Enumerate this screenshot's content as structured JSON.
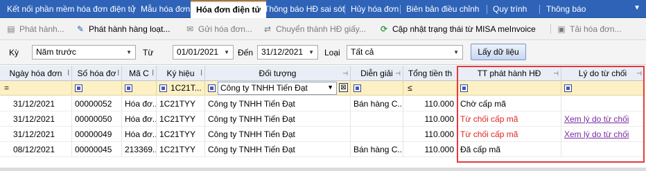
{
  "tabs": [
    {
      "label": "Kết nối phần mềm hóa đơn điện tử"
    },
    {
      "label": "Mẫu hóa đơn"
    },
    {
      "label": "Hóa đơn điện tử"
    },
    {
      "label": "Thông báo HĐ sai sót"
    },
    {
      "label": "Hủy hóa đơn"
    },
    {
      "label": "Biên bản điều chỉnh"
    },
    {
      "label": "Quy trình"
    },
    {
      "label": "Thông báo"
    }
  ],
  "toolbar": {
    "issue": "Phát hành...",
    "issue_batch": "Phát hành hàng loạt...",
    "send": "Gửi hóa đơn...",
    "convert": "Chuyển thành HĐ giấy...",
    "update_status": "Cập nhật trạng thái từ MISA meInvoice",
    "download": "Tải hóa đơn..."
  },
  "filter": {
    "period_label": "Kỳ",
    "period_value": "Năm trước",
    "from_label": "Từ",
    "from_value": "01/01/2021",
    "to_label": "Đến",
    "to_value": "31/12/2021",
    "type_label": "Loại",
    "type_value": "Tất cả",
    "get_data": "Lấy dữ liệu"
  },
  "columns": [
    {
      "label": "Ngày hóa đơn"
    },
    {
      "label": "Số hóa đơ"
    },
    {
      "label": "Mã C"
    },
    {
      "label": "Ký hiệu"
    },
    {
      "label": "Đối tượng"
    },
    {
      "label": "Diễn giải"
    },
    {
      "label": "Tổng tiền th"
    },
    {
      "label": "TT phát hành HĐ"
    },
    {
      "label": "Lý do từ chối"
    }
  ],
  "filter_row": {
    "op_first": "=",
    "kyhieu": "1C21T...",
    "doituong": "Công ty TNHH Tiến Đạt",
    "tongtien_op": "≤"
  },
  "rows": [
    {
      "date": "31/12/2021",
      "number": "00000052",
      "code": "Hóa đơ...",
      "symbol": "1C21TYY",
      "object": "Công ty TNHH Tiến Đạt",
      "desc": "Bán hàng C...",
      "total": "110.000",
      "status": "Chờ cấp mã",
      "reason": ""
    },
    {
      "date": "31/12/2021",
      "number": "00000050",
      "code": "Hóa đơ...",
      "symbol": "1C21TYY",
      "object": "Công ty TNHH Tiến Đạt",
      "desc": "",
      "total": "110.000",
      "status": "Từ chối cấp mã",
      "reason": "Xem lý do từ chối"
    },
    {
      "date": "31/12/2021",
      "number": "00000049",
      "code": "Hóa đơ...",
      "symbol": "1C21TYY",
      "object": "Công ty TNHH Tiến Đạt",
      "desc": "",
      "total": "110.000",
      "status": "Từ chối cấp mã",
      "reason": "Xem lý do từ chối"
    },
    {
      "date": "08/12/2021",
      "number": "00000045",
      "code": "213369...",
      "symbol": "1C21TYY",
      "object": "Công ty TNHH Tiến Đạt",
      "desc": "Bán hàng C...",
      "total": "110.000",
      "status": "Đã cấp mã",
      "reason": ""
    }
  ],
  "colors": {
    "tabbar": "#2e63b8",
    "active_tab_accent": "#f1a23b",
    "reject_text": "#e0251d",
    "link": "#7a2aa3",
    "highlight_border": "#e8383b",
    "filter_row": "#fdf0c4"
  }
}
